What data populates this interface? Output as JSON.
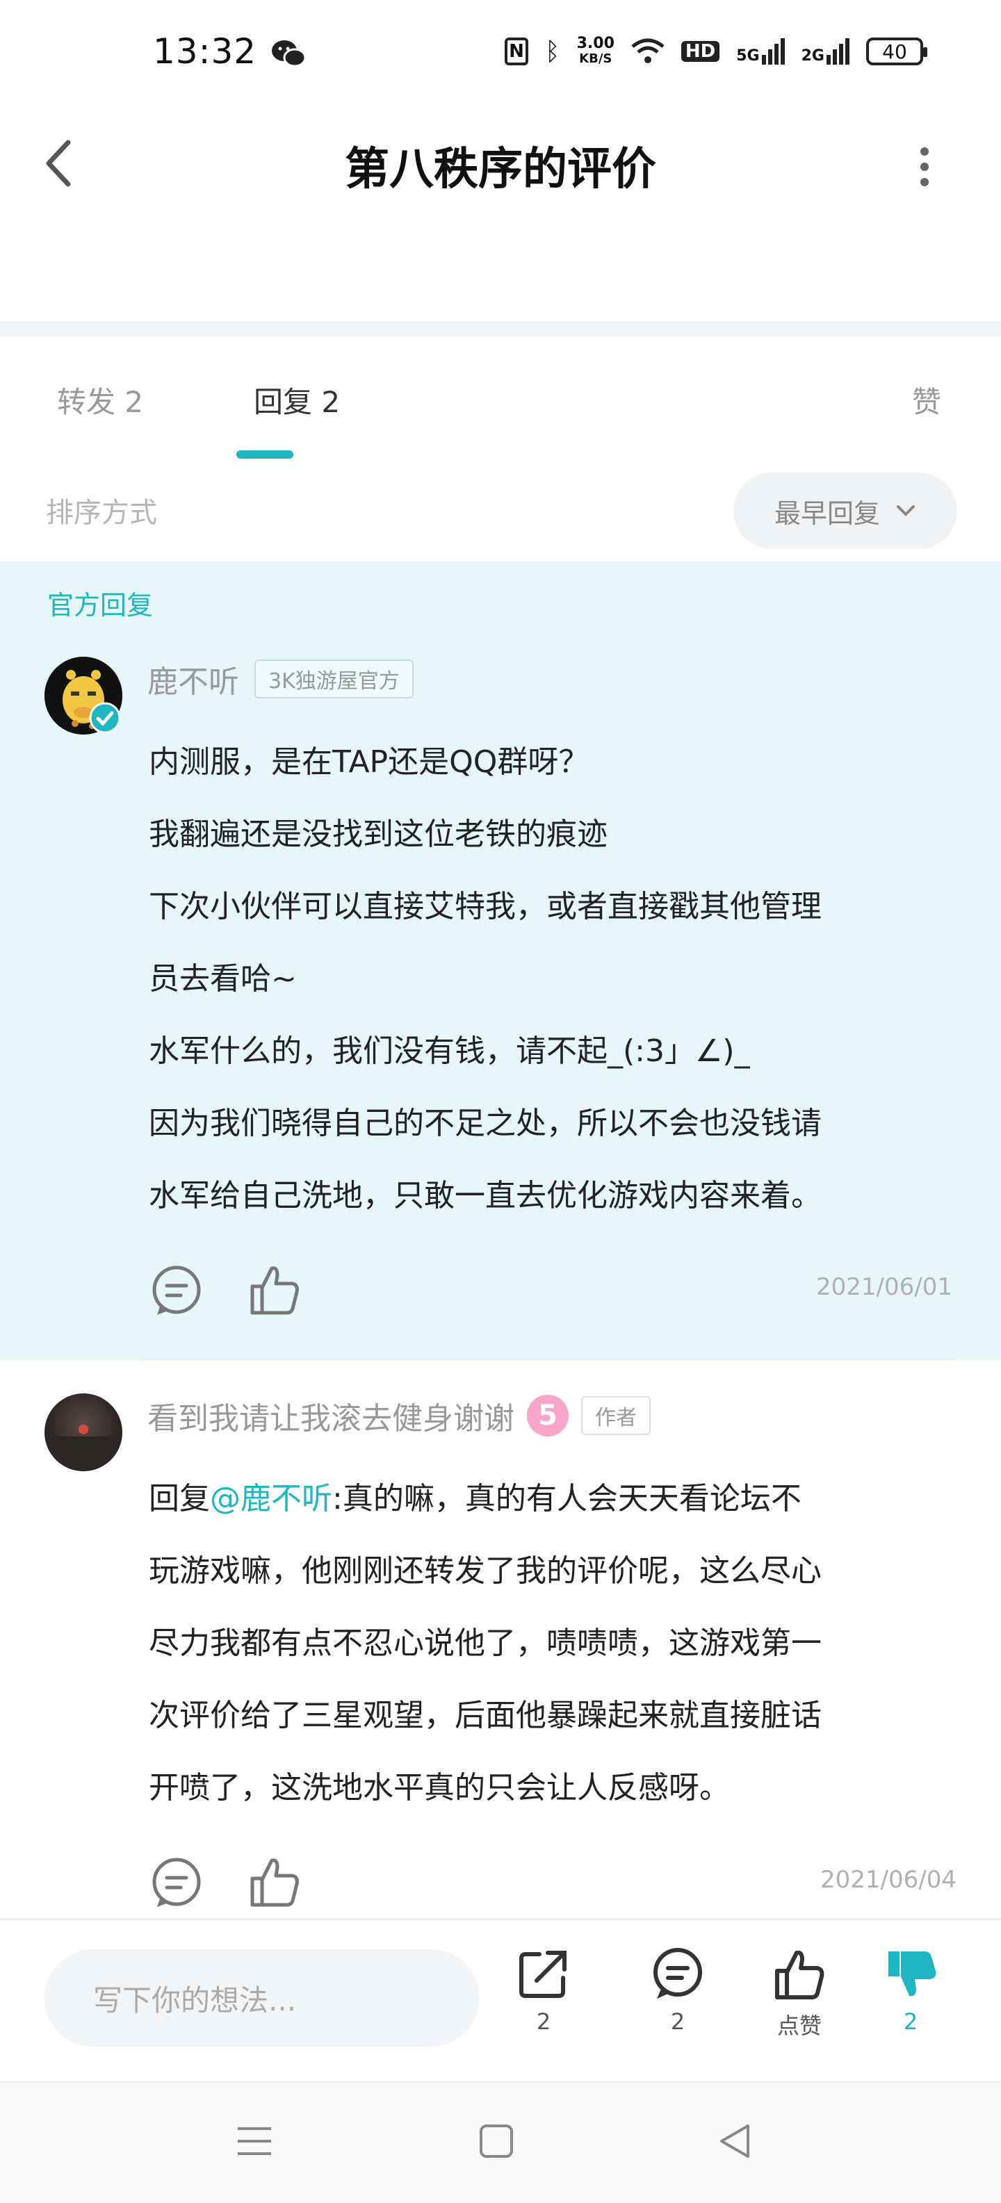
{
  "status_bar": {
    "time": "13:32",
    "speed_top": "3.00",
    "speed_unit": "KB/S",
    "hd": "HD",
    "net1": "5G",
    "net2": "2G",
    "battery": "40"
  },
  "header": {
    "title": "第八秩序的评价"
  },
  "tabs": [
    {
      "label": "转发 2"
    },
    {
      "label": "回复 2"
    },
    {
      "label": "赞"
    }
  ],
  "sort": {
    "label": "排序方式",
    "selected": "最早回复"
  },
  "official_reply": {
    "tag": "官方回复",
    "author": "鹿不听",
    "badge": "3K独游屋官方",
    "lines": [
      "内测服，是在TAP还是QQ群呀？",
      "我翻遍还是没找到这位老铁的痕迹",
      "下次小伙伴可以直接艾特我，或者直接戳其他管理",
      "员去看哈~",
      "水军什么的，我们没有钱，请不起_(:3」∠)_",
      "因为我们晓得自己的不足之处，所以不会也没钱请",
      "水军给自己洗地，只敢一直去优化游戏内容来着。"
    ],
    "date": "2021/06/01"
  },
  "reply": {
    "author": "看到我请让我滚去健身谢谢",
    "level": "5",
    "badge": "作者",
    "prefix": "回复",
    "mention": "@鹿不听",
    "line1_rest": ":真的嘛，真的有人会天天看论坛不",
    "lines": [
      "玩游戏嘛，他刚刚还转发了我的评价呢，这么尽心",
      "尽力我都有点不忍心说他了，啧啧啧，这游戏第一",
      "次评价给了三星观望，后面他暴躁起来就直接脏话",
      "开喷了，这洗地水平真的只会让人反感呀。"
    ],
    "date": "2021/06/04"
  },
  "bottom_bar": {
    "input_placeholder": "写下你的想法...",
    "share_count": "2",
    "comment_count": "2",
    "like_label": "点赞",
    "dislike_count": "2"
  },
  "colors": {
    "accent": "#1fb5c1",
    "official_bg": "#e7f7f8"
  }
}
